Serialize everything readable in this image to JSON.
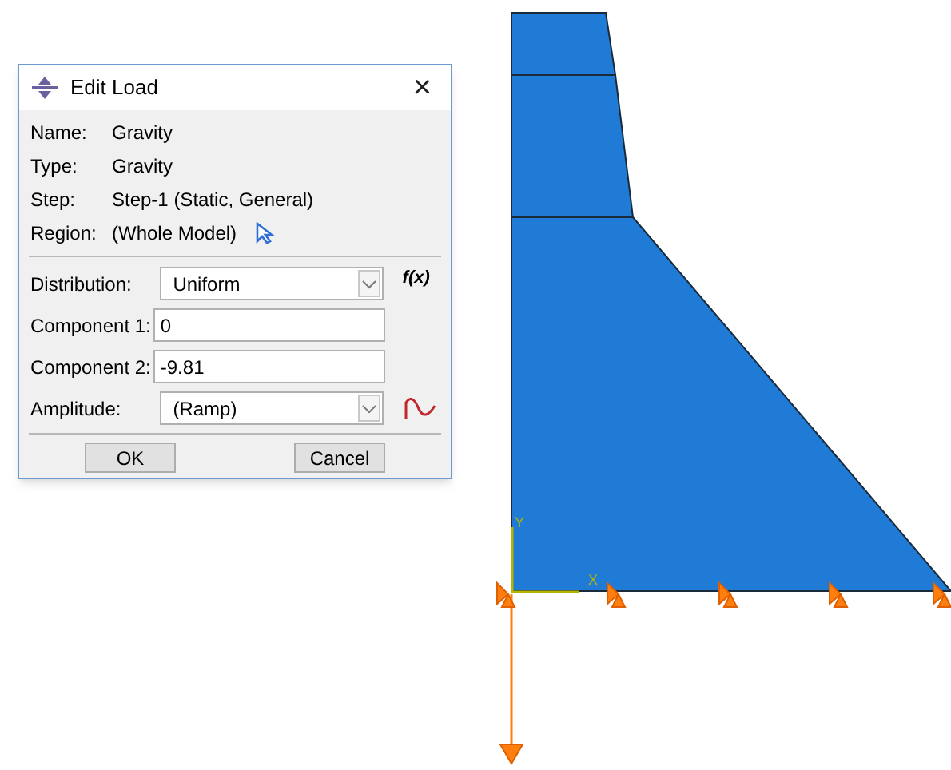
{
  "window": {
    "title": "Edit Load",
    "close": "×"
  },
  "info": [
    {
      "label": "Name:",
      "value": "Gravity"
    },
    {
      "label": "Type:",
      "value": "Gravity"
    },
    {
      "label": "Step:",
      "value": "Step-1 (Static, General)"
    },
    {
      "label": "Region:",
      "value": "(Whole Model)"
    }
  ],
  "fields": [
    {
      "kind": "select",
      "label": "Distribution:",
      "value": "Uniform",
      "side": "f(x)"
    },
    {
      "kind": "input",
      "label": "Component 1:",
      "value": "0"
    },
    {
      "kind": "input",
      "label": "Component 2:",
      "value": "-9.81"
    },
    {
      "kind": "select",
      "label": "Amplitude:",
      "value": "(Ramp)",
      "wave_button": true
    }
  ],
  "buttons": [
    "OK",
    "Cancel"
  ],
  "viewport": {
    "axis_labels": [
      "Y",
      "X"
    ]
  }
}
